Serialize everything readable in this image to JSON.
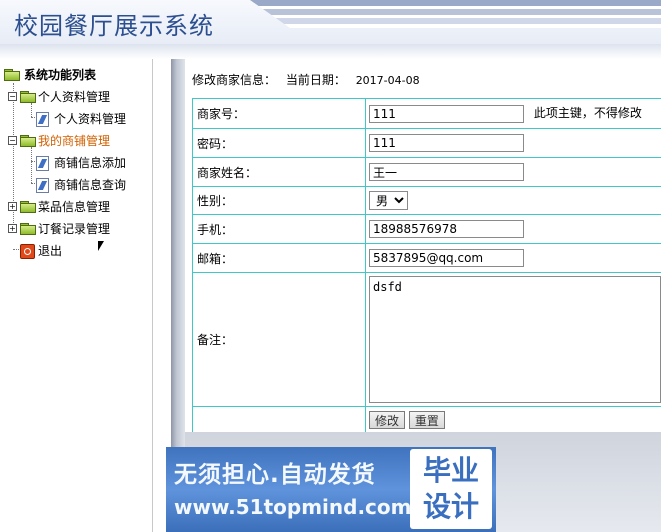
{
  "header": {
    "title": "校园餐厅展示系统"
  },
  "sidebar": {
    "root_label": "系统功能列表",
    "groups": [
      {
        "label": "个人资料管理",
        "children": [
          {
            "label": "个人资料管理"
          }
        ]
      },
      {
        "label": "我的商铺管理",
        "children": [
          {
            "label": "商铺信息添加"
          },
          {
            "label": "商铺信息查询"
          }
        ]
      },
      {
        "label": "菜品信息管理"
      },
      {
        "label": "订餐记录管理"
      }
    ],
    "exit_label": "退出"
  },
  "content": {
    "heading": "修改商家信息：",
    "date_label": "当前日期：",
    "date_value": "2017-04-08",
    "form": {
      "merchant_id_label": "商家号：",
      "merchant_id_value": "111",
      "merchant_id_note": "此项主键，不得修改",
      "password_label": "密码：",
      "password_value": "111",
      "name_label": "商家姓名：",
      "name_value": "王一",
      "gender_label": "性别：",
      "gender_value": "男",
      "phone_label": "手机：",
      "phone_value": "18988576978",
      "email_label": "邮箱：",
      "email_value": "5837895@qq.com",
      "remark_label": "备注：",
      "remark_value": "dsfd",
      "submit_label": "修改",
      "reset_label": "重置"
    }
  },
  "watermark": {
    "line1": "无须担心.自动发货",
    "line2": "www.51topmind.com",
    "seal_line1": "毕业",
    "seal_line2": "设计"
  },
  "colors": {
    "title": "#2b4f8f",
    "table_border": "#40c8c8",
    "active_menu": "#d06000",
    "watermark_bg": "#4f83cd"
  }
}
